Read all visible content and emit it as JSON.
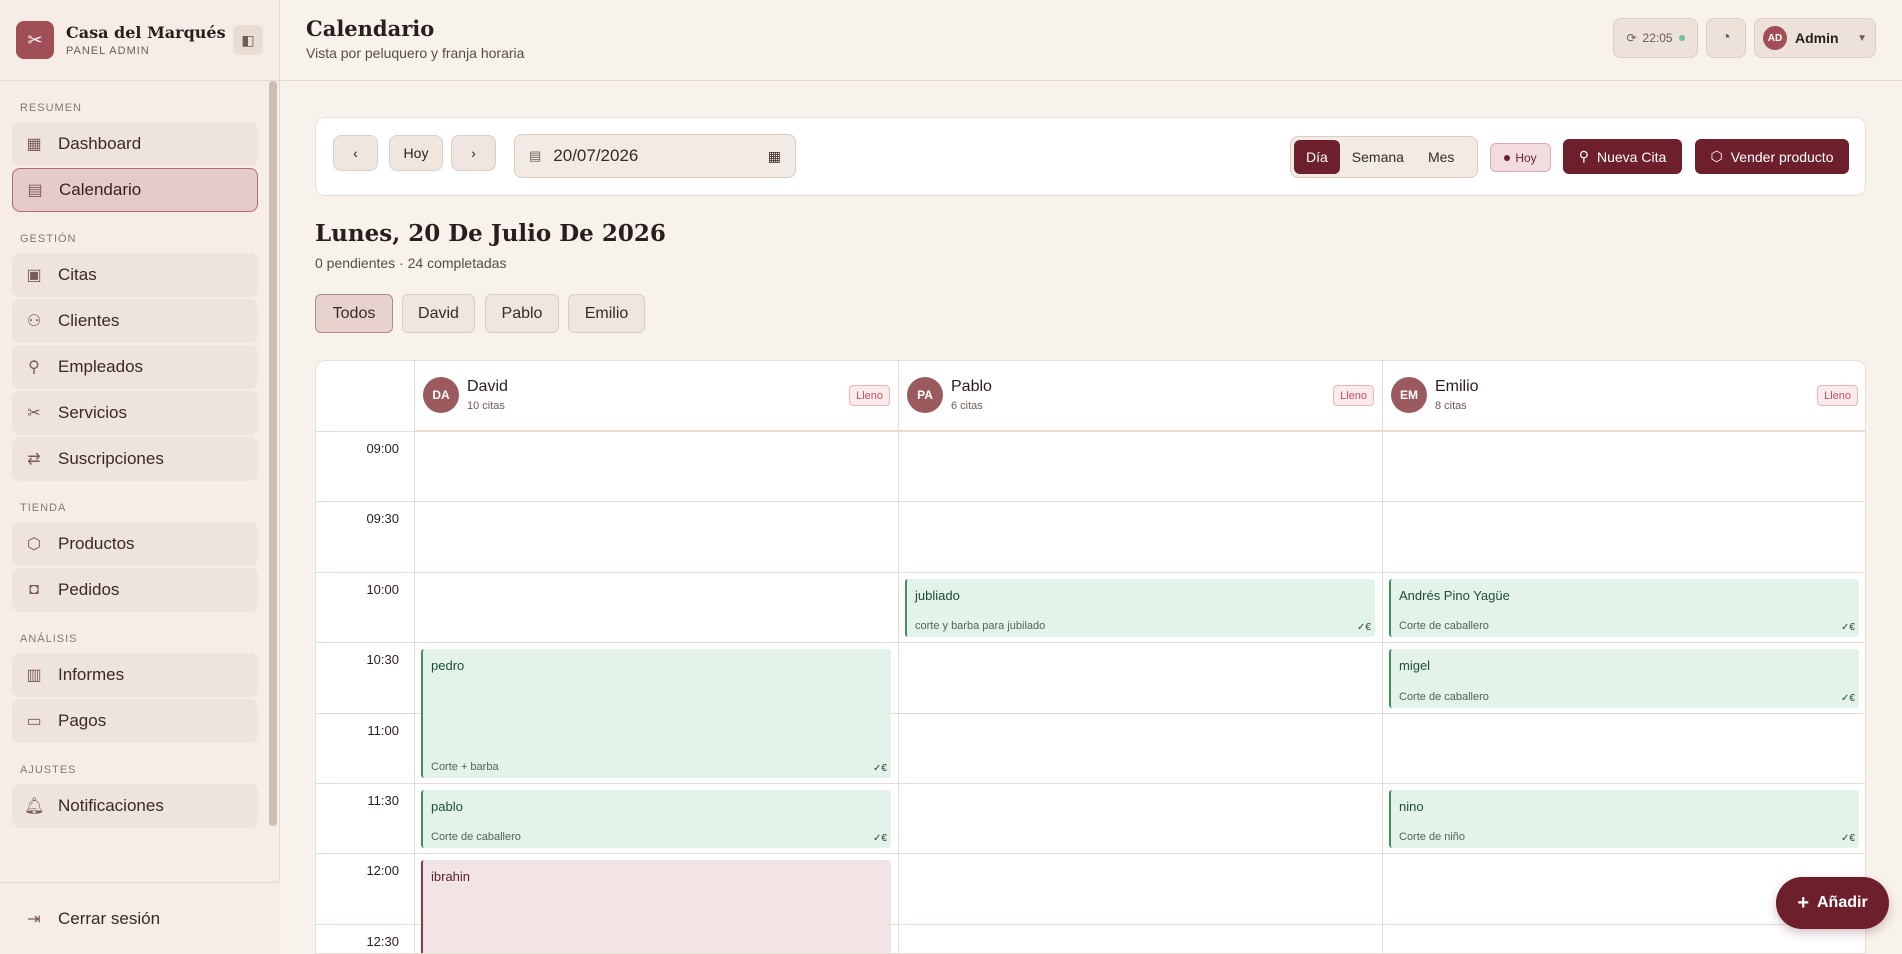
{
  "brand": {
    "name": "Casa del Marqués",
    "subtitle": "PANEL ADMIN"
  },
  "sidebar": {
    "sections": [
      {
        "title": "RESUMEN",
        "items": [
          "Dashboard",
          "Calendario"
        ]
      },
      {
        "title": "GESTIÓN",
        "items": [
          "Citas",
          "Clientes",
          "Empleados",
          "Servicios",
          "Suscripciones"
        ]
      },
      {
        "title": "TIENDA",
        "items": [
          "Productos",
          "Pedidos"
        ]
      },
      {
        "title": "ANÁLISIS",
        "items": [
          "Informes",
          "Pagos"
        ]
      },
      {
        "title": "AJUSTES",
        "items": [
          "Notificaciones"
        ]
      }
    ],
    "active": "Calendario",
    "logout": "Cerrar sesión"
  },
  "header": {
    "title": "Calendario",
    "subtitle": "Vista por peluquero y franja horaria",
    "sync_time": "22:05",
    "user_initials": "AD",
    "user_name": "Admin"
  },
  "toolbar": {
    "today_button": "Hoy",
    "date_value": "20/07/2026",
    "views": [
      "Día",
      "Semana",
      "Mes"
    ],
    "active_view": "Día",
    "today_badge": "Hoy",
    "new_appointment": "Nueva Cita",
    "sell_product": "Vender producto"
  },
  "day": {
    "title": "Lunes, 20 De Julio De 2026",
    "summary": "0 pendientes · 24 completadas"
  },
  "filters": {
    "items": [
      "Todos",
      "David",
      "Pablo",
      "Emilio"
    ],
    "active": "Todos"
  },
  "calendar": {
    "times": [
      "09:00",
      "09:30",
      "10:00",
      "10:30",
      "11:00",
      "11:30",
      "12:00",
      "12:30"
    ],
    "columns": [
      {
        "initials": "DA",
        "name": "David",
        "count": "10 citas",
        "status": "Lleno"
      },
      {
        "initials": "PA",
        "name": "Pablo",
        "count": "6 citas",
        "status": "Lleno"
      },
      {
        "initials": "EM",
        "name": "Emilio",
        "count": "8 citas",
        "status": "Lleno"
      }
    ],
    "appointments": [
      {
        "column": 0,
        "name": "pedro",
        "service": "Corte + barba",
        "slot": 3,
        "span": 2,
        "state": "done"
      },
      {
        "column": 0,
        "name": "pablo",
        "service": "Corte de caballero",
        "slot": 5,
        "span": 1,
        "state": "done"
      },
      {
        "column": 0,
        "name": "ibrahin",
        "service": "",
        "slot": 6,
        "span": 2,
        "state": "pending"
      },
      {
        "column": 1,
        "name": "jubliado",
        "service": "corte y barba para jubilado",
        "slot": 2,
        "span": 1,
        "state": "done"
      },
      {
        "column": 2,
        "name": "Andrés Pino Yagüe",
        "service": "Corte de caballero",
        "slot": 2,
        "span": 1,
        "state": "done"
      },
      {
        "column": 2,
        "name": "migel",
        "service": "Corte de caballero",
        "slot": 3,
        "span": 1,
        "state": "done"
      },
      {
        "column": 2,
        "name": "nino",
        "service": "Corte de niño",
        "slot": 5,
        "span": 1,
        "state": "done"
      }
    ]
  },
  "fab": {
    "label": "Añadir"
  }
}
